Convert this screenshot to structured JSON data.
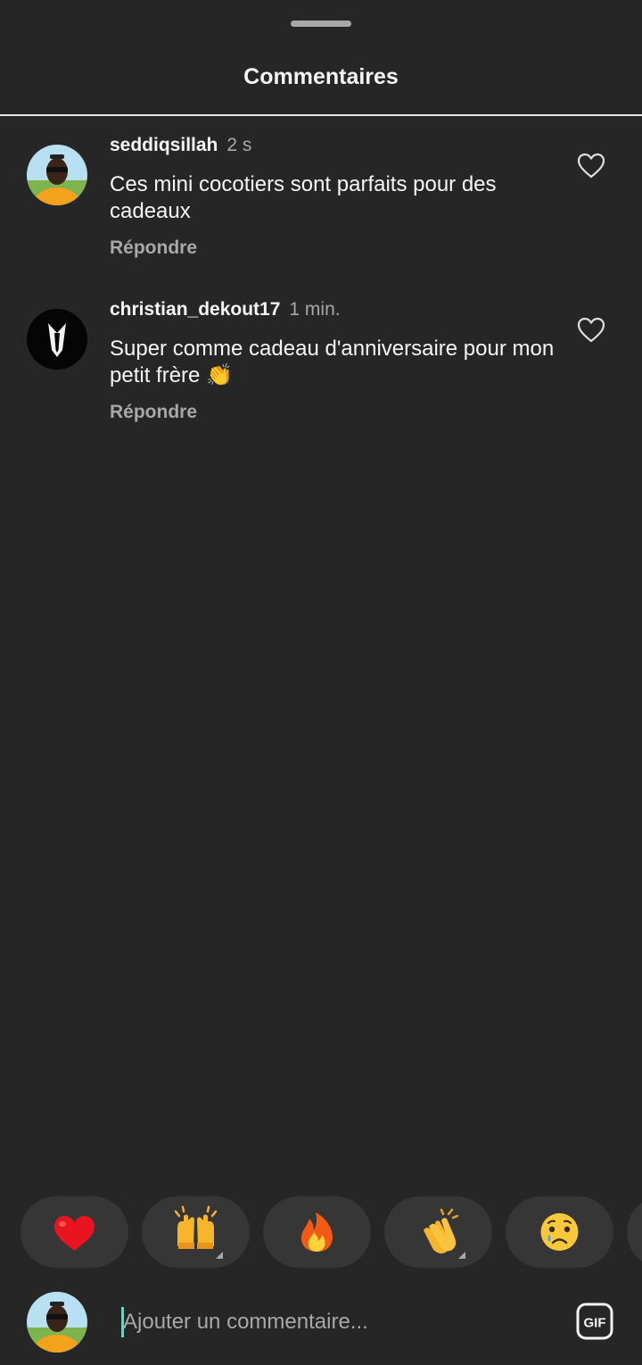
{
  "sheet": {
    "title": "Commentaires"
  },
  "comments": [
    {
      "username": "seddiqsillah",
      "time": "2 s",
      "text": "Ces mini cocotiers sont parfaits pour des cadeaux",
      "reply_label": "Répondre",
      "like_icon": "heart-outline-icon"
    },
    {
      "username": "christian_dekout17",
      "time": "1 min.",
      "text": "Super comme cadeau d'anniversaire pour mon petit frère 👏",
      "reply_label": "Répondre",
      "like_icon": "heart-outline-icon"
    }
  ],
  "reactions": [
    {
      "name": "red-heart",
      "glyph": "❤️",
      "has_variants": false
    },
    {
      "name": "raising-hands",
      "glyph": "🙌",
      "has_variants": true
    },
    {
      "name": "fire",
      "glyph": "🔥",
      "has_variants": false
    },
    {
      "name": "clapping-hands",
      "glyph": "👏",
      "has_variants": true
    },
    {
      "name": "crying-face",
      "glyph": "😢",
      "has_variants": false
    }
  ],
  "composer": {
    "placeholder": "Ajouter un commentaire...",
    "value": "",
    "gif_label": "GIF"
  },
  "colors": {
    "background": "#262626",
    "chip": "#363636",
    "primary_text": "#f5f5f5",
    "secondary_text": "#a8a8a8",
    "cursor": "#6fd3c0"
  }
}
